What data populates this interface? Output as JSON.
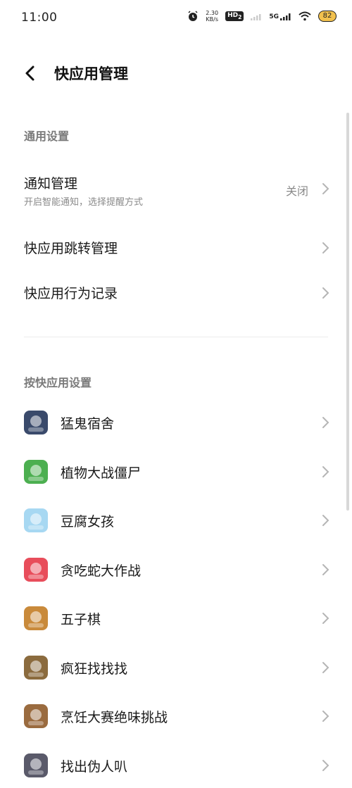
{
  "status": {
    "time": "11:00",
    "net_speed_value": "2.30",
    "net_speed_unit": "KB/s",
    "hd_label": "HD",
    "hd_sub": "2",
    "signal_label": "5G",
    "battery": "82"
  },
  "header": {
    "title": "快应用管理"
  },
  "general": {
    "header": "通用设置",
    "notification": {
      "title": "通知管理",
      "subtitle": "开启智能通知，选择提醒方式",
      "value": "关闭"
    },
    "redirect": {
      "title": "快应用跳转管理"
    },
    "behavior": {
      "title": "快应用行为记录"
    }
  },
  "apps_section": {
    "header": "按快应用设置"
  },
  "apps": [
    {
      "name": "猛鬼宿舍",
      "icon": "ghost-dorm-icon",
      "color": "#3a4a6b"
    },
    {
      "name": "植物大战僵尸",
      "icon": "zombie-icon",
      "color": "#4caf50"
    },
    {
      "name": "豆腐女孩",
      "icon": "tofu-girl-icon",
      "color": "#a7d8f2"
    },
    {
      "name": "贪吃蛇大作战",
      "icon": "snake-icon",
      "color": "#e84d5b"
    },
    {
      "name": "五子棋",
      "icon": "gomoku-icon",
      "color": "#c98a3b"
    },
    {
      "name": "疯狂找找找",
      "icon": "find-differences-icon",
      "color": "#8b6b3e"
    },
    {
      "name": "烹饪大赛绝味挑战",
      "icon": "cooking-icon",
      "color": "#9a6b3f"
    },
    {
      "name": "找出伪人叭",
      "icon": "find-impostor-icon",
      "color": "#5a5a6a"
    }
  ],
  "colors": {
    "text": "#1a1a1a",
    "secondary": "#8a8a8a",
    "section": "#7a7a7a",
    "chevron": "#b5b5b5"
  }
}
